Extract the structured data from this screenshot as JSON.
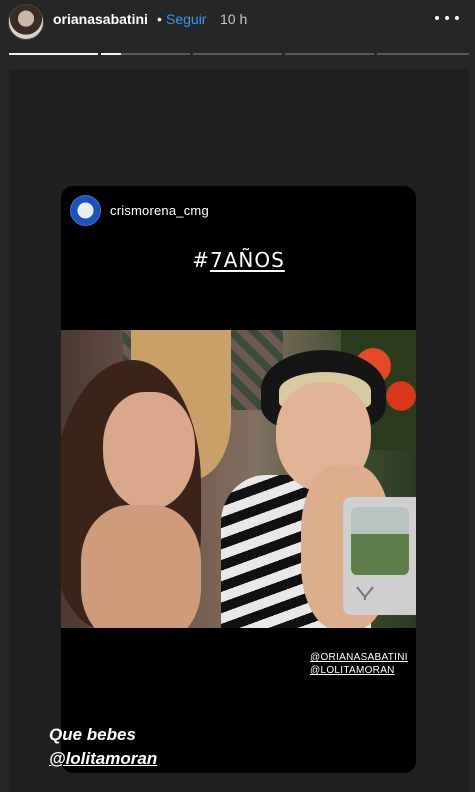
{
  "header": {
    "username": "orianasabatini",
    "separator": "•",
    "follow_label": "Seguir",
    "time": "10 h",
    "more_icon": "more-horizontal-icon"
  },
  "progress": {
    "segments": [
      1,
      0.22,
      0,
      0,
      0,
      0
    ]
  },
  "repost": {
    "username": "crismorena_cmg",
    "hashtag_prefix": "#",
    "hashtag_text": "7AÑOS",
    "mentions": [
      "@ORIANASABATINI",
      "@LOLITAMORAN"
    ]
  },
  "caption": {
    "line1": "Que bebes",
    "line2": "@lolitamoran"
  },
  "colors": {
    "background": "#262626",
    "accent": "#3897f0",
    "card": "#000000"
  }
}
